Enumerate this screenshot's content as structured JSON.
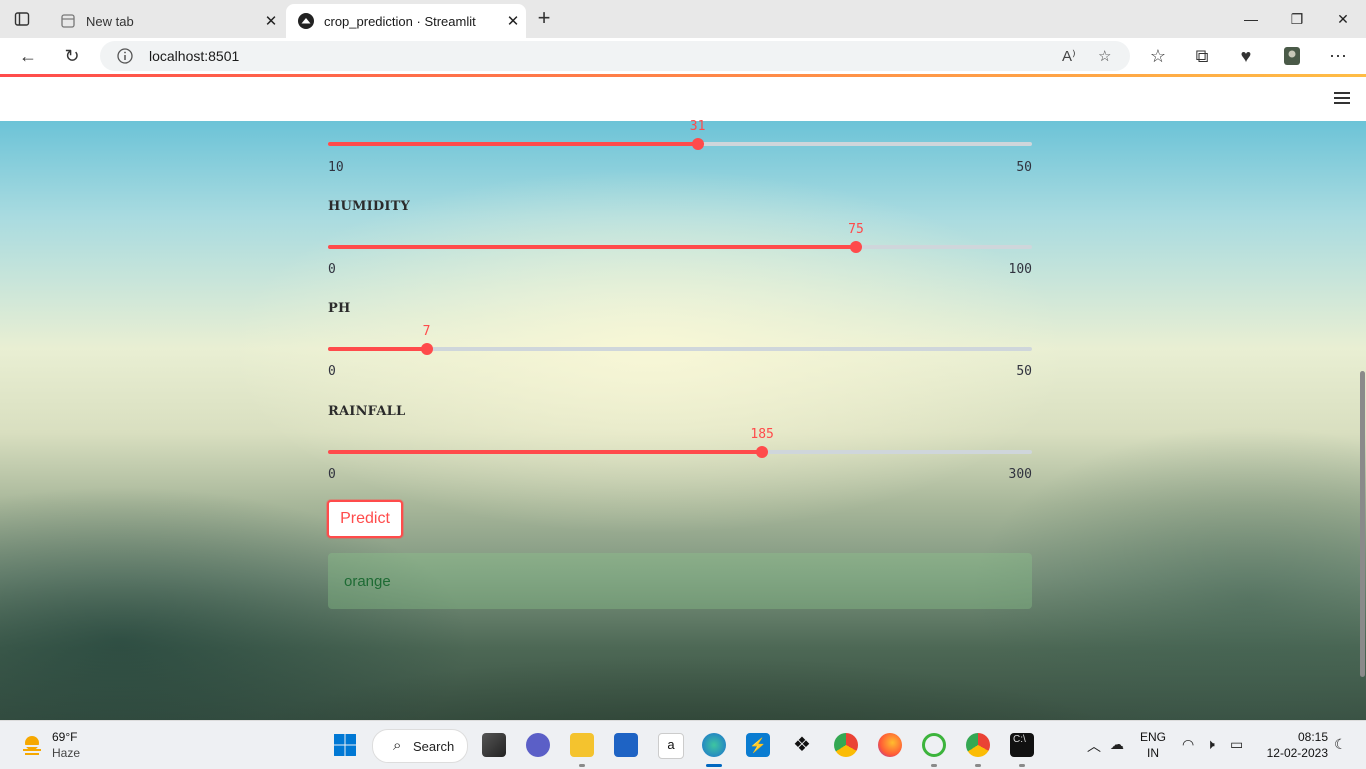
{
  "browser": {
    "tabs": [
      {
        "label": "New tab"
      },
      {
        "label": "crop_prediction · Streamlit"
      }
    ],
    "url": "localhost:8501"
  },
  "sliders": [
    {
      "label": "",
      "min": "10",
      "max": "50",
      "value": "31",
      "min_num": 10,
      "max_num": 50,
      "value_num": 31
    },
    {
      "label": "HUMIDITY",
      "min": "0",
      "max": "100",
      "value": "75",
      "min_num": 0,
      "max_num": 100,
      "value_num": 75
    },
    {
      "label": "PH",
      "min": "0",
      "max": "50",
      "value": "7",
      "min_num": 0,
      "max_num": 50,
      "value_num": 7
    },
    {
      "label": "RAINFALL",
      "min": "0",
      "max": "300",
      "value": "185",
      "min_num": 0,
      "max_num": 300,
      "value_num": 185
    }
  ],
  "predict_button": {
    "label": "Predict"
  },
  "result": {
    "text": "orange"
  },
  "colors": {
    "accent": "#ff4b4b",
    "success_text": "#1e6b34",
    "track": "#cfd6db"
  },
  "taskbar": {
    "weather": {
      "temp": "69°F",
      "condition": "Haze"
    },
    "search_label": "Search",
    "language": {
      "line1": "ENG",
      "line2": "IN"
    },
    "clock": {
      "time": "08:15",
      "date": "12-02-2023"
    }
  }
}
